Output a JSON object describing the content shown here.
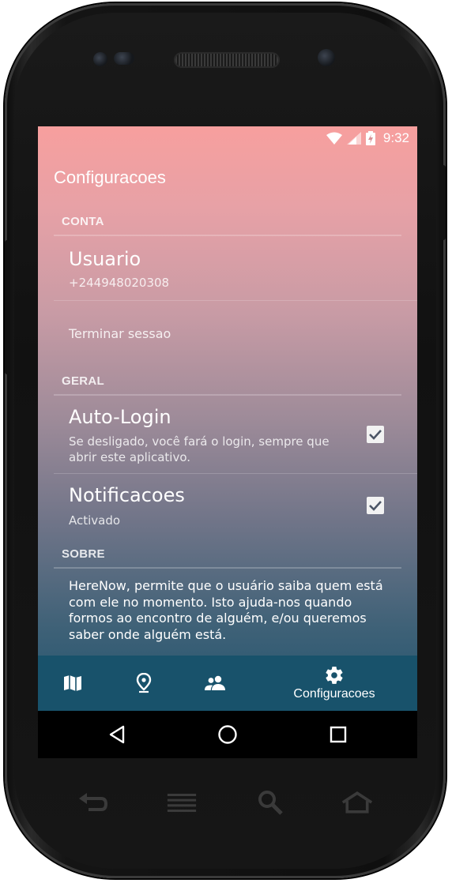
{
  "status_bar": {
    "time": "9:32"
  },
  "page": {
    "title": "Configuracoes"
  },
  "sections": {
    "conta": {
      "header": "CONTA"
    },
    "geral": {
      "header": "GERAL"
    },
    "sobre": {
      "header": "SOBRE"
    }
  },
  "account": {
    "user_title": "Usuario",
    "user_phone": "+244948020308",
    "logout_label": "Terminar sessao"
  },
  "general": {
    "autologin_title": "Auto-Login",
    "autologin_summary_line1": "Se desligado, você fará o login, sempre que",
    "autologin_summary_line2": "abrir este aplicativo.",
    "autologin_checked": true,
    "notifications_title": "Notificacoes",
    "notifications_summary": "Activado",
    "notifications_checked": true
  },
  "about": {
    "line1": "HereNow, permite que o usuário saiba quem está",
    "line2": "com ele no momento. Isto ajuda-nos quando",
    "line3": "formos ao encontro de alguém, e/ou queremos",
    "line4": "saber onde alguém está."
  },
  "bottom_nav": {
    "items": [
      {
        "icon": "map-icon",
        "label": ""
      },
      {
        "icon": "location-pin-icon",
        "label": ""
      },
      {
        "icon": "people-icon",
        "label": ""
      },
      {
        "icon": "gear-icon",
        "label": "Configuracoes",
        "active": true
      }
    ]
  },
  "colors": {
    "gradient_top": "#f79f9e",
    "gradient_bottom": "#23546f",
    "bottom_nav_bg": "#18526b"
  }
}
